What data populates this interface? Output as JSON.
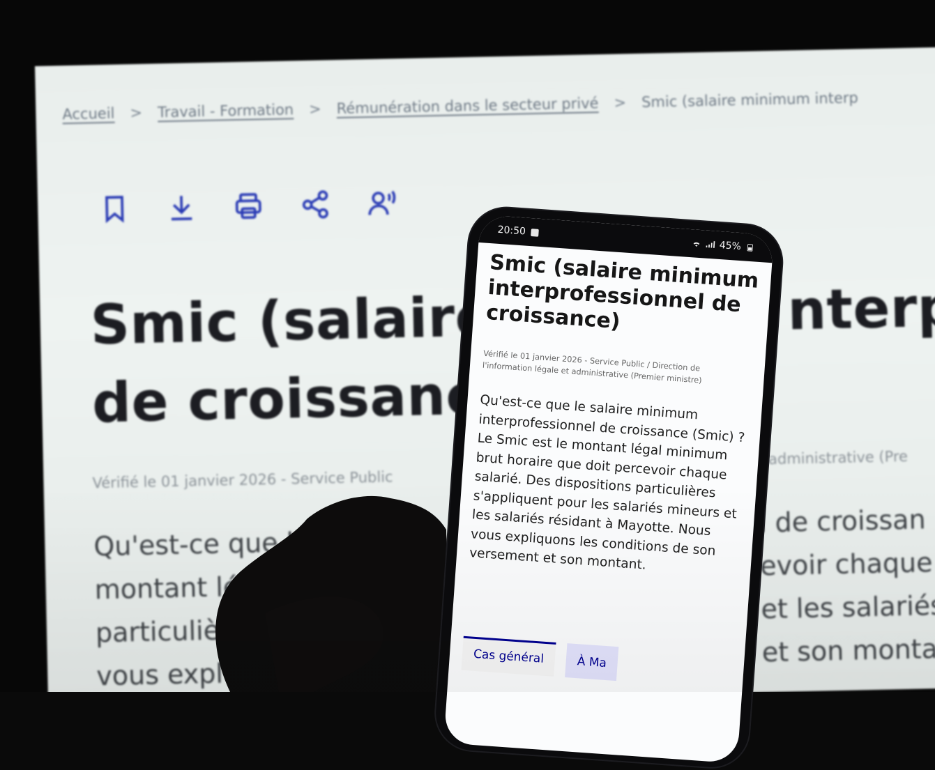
{
  "background_page": {
    "breadcrumb": [
      "Accueil",
      "Travail - Formation",
      "Rémunération dans le secteur privé",
      "Smic (salaire minimum interp"
    ],
    "breadcrumb_separator": ">",
    "toolbar_icons": [
      "bookmark-icon",
      "download-icon",
      "print-icon",
      "share-icon",
      "listen-icon"
    ],
    "title_line1": "Smic (salaire",
    "title_line1_right": "nterp",
    "title_line2": "de croissanc",
    "verified": "Vérifié le 01 janvier 2026 - Service Public",
    "verified_right": "administrative (Pre",
    "body_lines": [
      "Qu'est-ce que l",
      "montant léga",
      "particulièr",
      "vous expl"
    ],
    "body_right_lines": [
      "l de croissan",
      "evoir chaque",
      "et les salariés",
      "et son montar"
    ],
    "accent_color": "#000091"
  },
  "phone": {
    "status_time": "20:50",
    "status_battery": "45%",
    "title": "Smic (salaire minimum interprofessionnel de croissance)",
    "verified": "Vérifié le 01 janvier 2026 - Service Public / Direction de l'information légale et administrative (Premier ministre)",
    "body": "Qu'est-ce que le salaire minimum interprofessionnel de croissance (Smic) ? Le Smic est le montant légal minimum brut horaire que doit percevoir chaque salarié. Des dispositions particulières s'appliquent pour les salariés mineurs et les salariés résidant à Mayotte. Nous vous expliquons les conditions de son versement et son montant.",
    "tabs": [
      "Cas général",
      "À Ma"
    ]
  }
}
